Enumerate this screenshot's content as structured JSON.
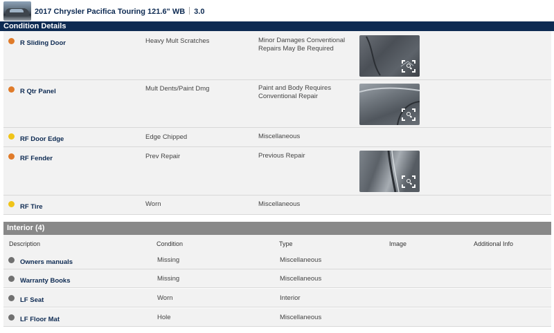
{
  "header": {
    "vehicle_title": "2017 Chrysler Pacifica Touring 121.6\" WB",
    "grade": "3.0"
  },
  "condition": {
    "section_title": "Condition Details",
    "rows": [
      {
        "description": "R Sliding Door",
        "condition": "Heavy Mult Scratches",
        "type": "Minor Damages Conventional Repairs May Be Required",
        "severity": "orange",
        "has_image": true
      },
      {
        "description": "R Qtr Panel",
        "condition": "Mult Dents/Paint Dmg",
        "type": "Paint and Body Requires Conventional Repair",
        "severity": "orange",
        "has_image": true
      },
      {
        "description": "RF Door Edge",
        "condition": "Edge Chipped",
        "type": "Miscellaneous",
        "severity": "yellow",
        "has_image": false
      },
      {
        "description": "RF Fender",
        "condition": "Prev Repair",
        "type": "Previous Repair",
        "severity": "orange",
        "has_image": true
      },
      {
        "description": "RF Tire",
        "condition": "Worn",
        "type": "Miscellaneous",
        "severity": "yellow",
        "has_image": false
      }
    ]
  },
  "interior": {
    "section_title": "Interior (4)",
    "columns": [
      "Description",
      "Condition",
      "Type",
      "Image",
      "Additional Info"
    ],
    "rows": [
      {
        "description": "Owners manuals",
        "condition": "Missing",
        "type": "Miscellaneous"
      },
      {
        "description": "Warranty Books",
        "condition": "Missing",
        "type": "Miscellaneous"
      },
      {
        "description": "LF Seat",
        "condition": "Worn",
        "type": "Interior"
      },
      {
        "description": "LF Floor Mat",
        "condition": "Hole",
        "type": "Miscellaneous"
      }
    ]
  },
  "colors": {
    "navy": "#0d2a52",
    "orange": "#e07b2a",
    "yellow": "#f0c419",
    "gray": "#707070"
  }
}
